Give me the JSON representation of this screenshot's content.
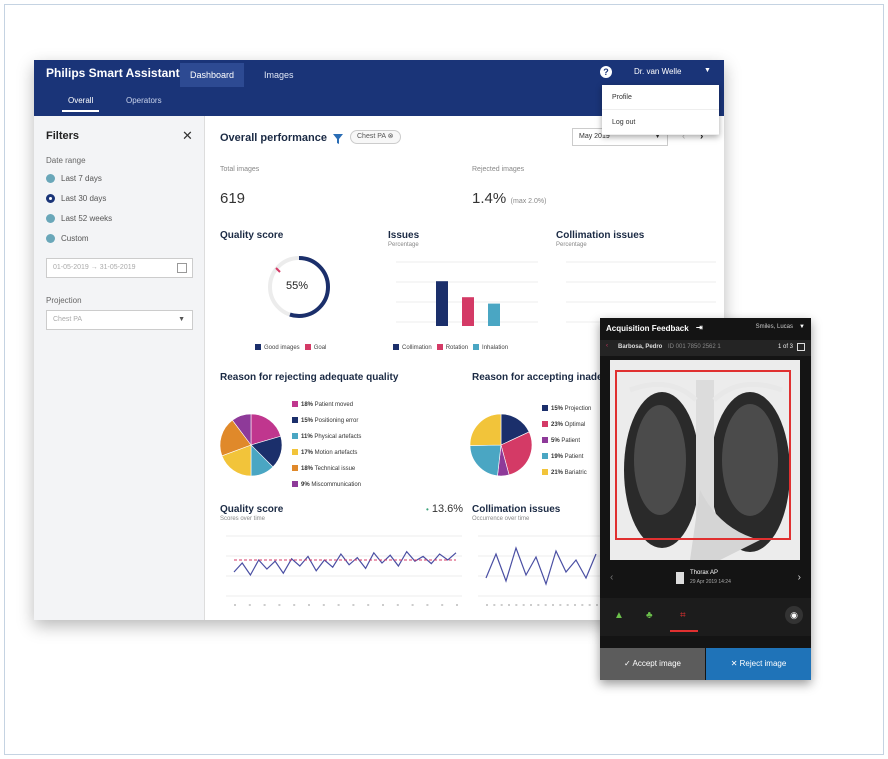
{
  "app": {
    "title": "Philips Smart Assistant",
    "nav_tabs": [
      "Dashboard",
      "Images"
    ],
    "sub_tabs": [
      "Overall",
      "Operators"
    ],
    "user": "Dr. van Welle",
    "user_menu": [
      "Profile",
      "Log out"
    ]
  },
  "filters": {
    "title": "Filters",
    "date_range_label": "Date range",
    "date_options": [
      "Last 7 days",
      "Last 30 days",
      "Last 52 weeks",
      "Custom"
    ],
    "selected_date_option": "Last 30 days",
    "date_input": "01-05-2019 → 31-05-2019",
    "projection_label": "Projection",
    "projection_value": "Chest PA"
  },
  "dashboard": {
    "title": "Overall performance",
    "filter_chip": "Chest PA",
    "month": "May 2019",
    "total_images_label": "Total images",
    "total_images_value": "619",
    "rejected_images_label": "Rejected images",
    "rejected_images_value": "1.4%",
    "rejected_images_max": "(max 2.0%)",
    "quality_score_title": "Quality score",
    "quality_score_value": "55%",
    "quality_legend": [
      "Good images",
      "Goal"
    ],
    "issues_title": "Issues",
    "issues_sub": "Percentage",
    "issues_legend": [
      "Collimation",
      "Rotation",
      "Inhalation"
    ],
    "collimation_title": "Collimation issues",
    "collimation_sub": "Percentage",
    "reject_reasons_title": "Reason for rejecting adequate quality",
    "accept_reasons_title": "Reason for accepting inadequate quality",
    "quality_trend_title": "Quality score",
    "quality_trend_sub": "Scores over time",
    "quality_trend_value": "13.6%",
    "collimation_trend_title": "Collimation issues",
    "collimation_trend_sub": "Occurrence over time"
  },
  "chart_data": [
    {
      "type": "pie",
      "title": "Quality score",
      "values": [
        55
      ],
      "labels": [
        "55%"
      ]
    },
    {
      "type": "bar",
      "title": "Issues",
      "categories": [
        "Collimation",
        "Rotation",
        "Inhalation"
      ],
      "values": [
        28,
        18,
        14
      ],
      "colors": [
        "#1b2f6b",
        "#d43a66",
        "#4aa6c3"
      ]
    },
    {
      "type": "pie",
      "title": "Reason for rejecting adequate quality",
      "labels": [
        "Patient moved",
        "Positioning error",
        "Physical artefacts",
        "Motion artefacts",
        "Technical issue",
        "Miscommunication"
      ],
      "values": [
        18,
        15,
        11,
        17,
        18,
        9
      ],
      "label_texts": [
        "18%",
        "15%",
        "11%",
        "17%",
        "18%",
        "9%"
      ],
      "colors": [
        "#c0368e",
        "#1b2f6b",
        "#4aa6c3",
        "#f2c43a",
        "#e0892a",
        "#8e3a99"
      ]
    },
    {
      "type": "pie",
      "title": "Reason for accepting inadequate quality",
      "labels": [
        "Projection",
        "Optimal",
        "Patient",
        "Patient",
        "Bariatric"
      ],
      "values": [
        15,
        23,
        5,
        19,
        21
      ],
      "label_texts": [
        "15%",
        "23%",
        "5%",
        "19%",
        "21%"
      ],
      "colors": [
        "#1b2f6b",
        "#d43a66",
        "#8e3a99",
        "#4aa6c3",
        "#f2c43a"
      ]
    },
    {
      "type": "line",
      "title": "Quality score",
      "x": [
        1,
        2,
        3,
        4,
        5,
        6,
        7,
        8,
        9,
        10,
        11,
        12,
        13,
        14,
        15,
        16,
        17,
        18,
        19,
        20,
        21,
        22,
        23,
        24,
        25,
        26,
        27,
        28
      ],
      "values": [
        40,
        55,
        35,
        60,
        45,
        58,
        38,
        62,
        50,
        66,
        42,
        60,
        48,
        70,
        52,
        64,
        46,
        72,
        55,
        68,
        50,
        74,
        58,
        66,
        54,
        70,
        60,
        72
      ]
    },
    {
      "type": "line",
      "title": "Collimation issues",
      "x": [
        1,
        2,
        3,
        4,
        5,
        6,
        7,
        8,
        9,
        10,
        11,
        12
      ],
      "values": [
        30,
        70,
        25,
        80,
        35,
        65,
        20,
        75,
        40,
        60,
        30,
        70
      ]
    }
  ],
  "phone": {
    "title": "Acquisition Feedback",
    "operator": "Smiles, Lucas",
    "patient": "Barbosa, Pedro",
    "patient_id": "ID 001 7850 2562 1",
    "counter": "1 of 3",
    "exam": "Thorax AP",
    "exam_date": "29 Apr 2019 14:24",
    "accept_label": "Accept image",
    "reject_label": "Reject image"
  },
  "colors": {
    "navy": "#1a3478",
    "accent_blue": "#1f73b8",
    "pink": "#d43a66",
    "teal": "#4aa6c3"
  }
}
